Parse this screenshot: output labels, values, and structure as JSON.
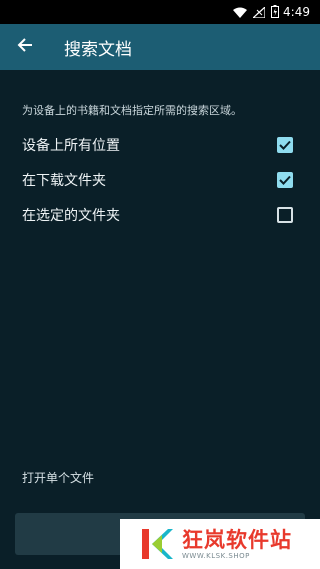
{
  "status_bar": {
    "time": "4:49",
    "icons": [
      "wifi-icon",
      "signal-icon",
      "battery-icon"
    ]
  },
  "appbar": {
    "back_icon": "arrow-left-icon",
    "title": "搜索文档",
    "color": "#1c5d73"
  },
  "description": "为设备上的书籍和文档指定所需的搜索区域。",
  "options": [
    {
      "label": "设备上所有位置",
      "checked": true
    },
    {
      "label": "在下载文件夹",
      "checked": true
    },
    {
      "label": "在选定的文件夹",
      "checked": false
    }
  ],
  "open_single_file": "打开单个文件",
  "watermark": {
    "title": "狂岚软件站",
    "subtitle": "WWW.KLSK.SHOP"
  },
  "colors": {
    "background": "#0a1f28",
    "accent": "#8fdcef",
    "watermark_red": "#e8392c"
  }
}
